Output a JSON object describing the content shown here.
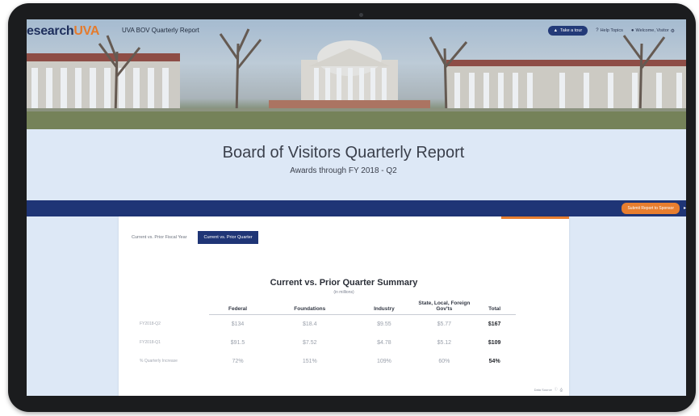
{
  "header": {
    "brand_part1": "esearch",
    "brand_part2": "UVA",
    "site_title": "UVA BOV Quarterly Report",
    "nav": {
      "primary_button": "Take a tour",
      "link_help": "Help Topics",
      "link_account": "Welcome, Visitor"
    }
  },
  "page": {
    "title": "Board of Visitors Quarterly Report",
    "subtitle": "Awards through FY 2018 - Q2"
  },
  "navbar": {
    "submit_button": "Submit Report to Sponsor"
  },
  "tabs": [
    {
      "label": "Current vs. Prior Fiscal Year",
      "active": false
    },
    {
      "label": "Current vs. Prior Quarter",
      "active": true
    }
  ],
  "summary": {
    "title": "Current vs. Prior Quarter Summary",
    "units": "(in millions)",
    "columns": [
      "Federal",
      "Foundations",
      "Industry",
      "State, Local, Foreign Gov'ts",
      "Total"
    ],
    "rows": [
      {
        "label": "FY2018-Q2",
        "values": [
          "$134",
          "$18.4",
          "$9.55",
          "$5.77",
          "$167"
        ]
      },
      {
        "label": "FY2018-Q1",
        "values": [
          "$91.5",
          "$7.52",
          "$4.78",
          "$5.12",
          "$109"
        ]
      },
      {
        "label": "% Quarterly Increase",
        "values": [
          "72%",
          "151%",
          "109%",
          "60%",
          "54%"
        ]
      }
    ],
    "footer": "Data Source"
  },
  "colors": {
    "navy": "#1f3576",
    "orange": "#e87e2f",
    "page_bg": "#dde8f6"
  }
}
